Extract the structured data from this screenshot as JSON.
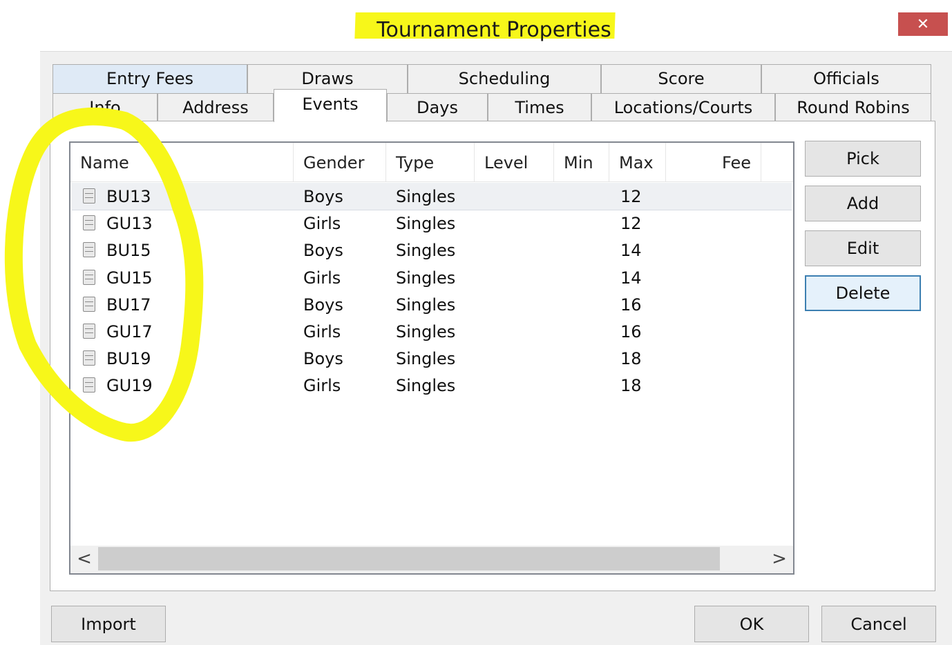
{
  "window": {
    "title": "Tournament Properties",
    "close_label": "✕"
  },
  "tabs": {
    "row1": [
      "Entry Fees",
      "Draws",
      "Scheduling",
      "Score",
      "Officials"
    ],
    "row2": [
      "Info",
      "Address",
      "Events",
      "Days",
      "Times",
      "Locations/Courts",
      "Round Robins"
    ],
    "selected": "Events"
  },
  "events_list": {
    "columns": [
      "Name",
      "Gender",
      "Type",
      "Level",
      "Min",
      "Max",
      "Fee"
    ],
    "rows": [
      {
        "name": "BU13",
        "gender": "Boys",
        "type": "Singles",
        "level": "",
        "min": "",
        "max": "12",
        "fee": ""
      },
      {
        "name": "GU13",
        "gender": "Girls",
        "type": "Singles",
        "level": "",
        "min": "",
        "max": "12",
        "fee": ""
      },
      {
        "name": "BU15",
        "gender": "Boys",
        "type": "Singles",
        "level": "",
        "min": "",
        "max": "14",
        "fee": ""
      },
      {
        "name": "GU15",
        "gender": "Girls",
        "type": "Singles",
        "level": "",
        "min": "",
        "max": "14",
        "fee": ""
      },
      {
        "name": "BU17",
        "gender": "Boys",
        "type": "Singles",
        "level": "",
        "min": "",
        "max": "16",
        "fee": ""
      },
      {
        "name": "GU17",
        "gender": "Girls",
        "type": "Singles",
        "level": "",
        "min": "",
        "max": "16",
        "fee": ""
      },
      {
        "name": "BU19",
        "gender": "Boys",
        "type": "Singles",
        "level": "",
        "min": "",
        "max": "18",
        "fee": ""
      },
      {
        "name": "GU19",
        "gender": "Girls",
        "type": "Singles",
        "level": "",
        "min": "",
        "max": "18",
        "fee": ""
      }
    ],
    "row_icon": "database-icon"
  },
  "side_buttons": {
    "pick": "Pick",
    "add": "Add",
    "edit": "Edit",
    "delete": "Delete"
  },
  "bottom_buttons": {
    "import": "Import",
    "ok": "OK",
    "cancel": "Cancel"
  },
  "scrollbar": {
    "left_arrow": "<",
    "right_arrow": ">"
  },
  "colors": {
    "highlight": "#f7f71a",
    "close_button": "#c7504f",
    "focus_border": "#3c7fb1"
  }
}
